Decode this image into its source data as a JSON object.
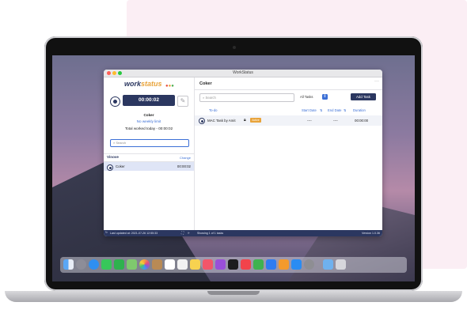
{
  "window": {
    "title": "WorkStatus"
  },
  "brand": {
    "logo_work": "work",
    "logo_status": "status"
  },
  "timer": {
    "value": "00:00:02"
  },
  "user": {
    "name": "Coker",
    "weekly_limit": "No weekly limit",
    "total_today": "Total worked today - 00:00:02"
  },
  "left_search": {
    "placeholder": "Search"
  },
  "organization": {
    "name": "Vinove",
    "change_label": "Change"
  },
  "member_row": {
    "name": "Coker",
    "time": "00:00:02"
  },
  "right": {
    "header": "Coker",
    "search_placeholder": "Search",
    "filter_value": "All Tasks",
    "add_task_label": "Add Task",
    "columns": {
      "todo": "To-do",
      "start": "Start Date",
      "end": "End Date",
      "duration": "Duration"
    },
    "task": {
      "name": "MAC Task by Amit",
      "tag": "Active",
      "start": "----",
      "end": "----",
      "duration": "00:00:00"
    }
  },
  "statusbar": {
    "last_updated": "Last updated at: 2021-07-26 12:55:33",
    "showing": "Showing 1 of 1 tasks",
    "version": "Version 1.0.36"
  },
  "colors": {
    "brand_navy": "#2b3760",
    "accent_orange": "#e8a33a",
    "link_blue": "#3b6fd6",
    "selected_row": "#dfe5f6",
    "background_pink": "#fbeef4"
  },
  "dock": {
    "icons": [
      "finder-icon",
      "launchpad-icon",
      "safari-icon",
      "messages-icon",
      "facetime-icon",
      "maps-icon",
      "photos-icon",
      "contacts-icon",
      "calendar-icon",
      "reminders-icon",
      "notes-icon",
      "music-icon",
      "podcasts-icon",
      "appletv-icon",
      "news-icon",
      "numbers-icon",
      "keynote-icon",
      "pages-icon",
      "appstore-icon",
      "system-preferences-icon",
      "folder-icon",
      "trash-icon"
    ]
  }
}
